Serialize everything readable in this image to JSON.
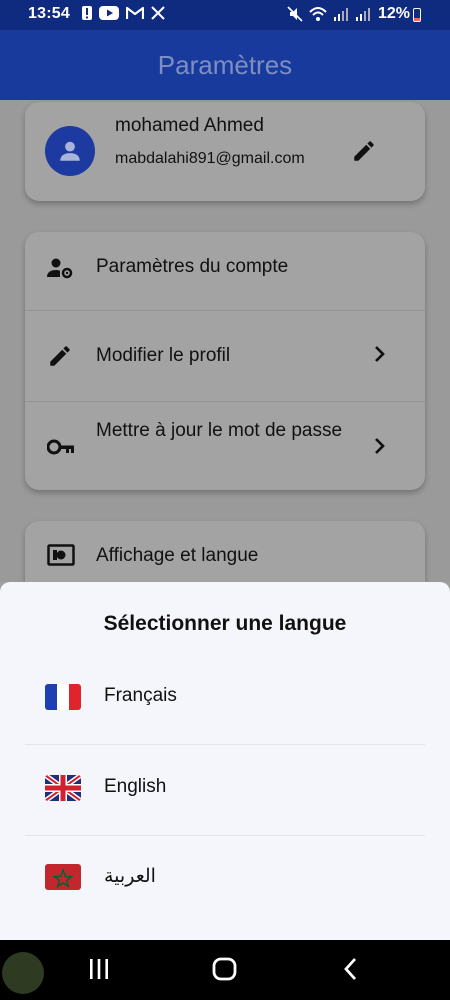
{
  "status_bar": {
    "time": "13:54",
    "battery": "12%",
    "left_icons": [
      "alert-icon",
      "youtube-icon",
      "gmail-icon",
      "x-icon"
    ],
    "right_icons": [
      "mute-icon",
      "wifi-icon",
      "signal-icon",
      "signal-icon"
    ]
  },
  "app_bar": {
    "title": "Paramètres"
  },
  "profile": {
    "name": "mohamed Ahmed",
    "email": "mabdalahi891@gmail.com"
  },
  "account_settings": {
    "items": [
      {
        "label": "Paramètres du compte",
        "icon": "user-gear-icon"
      },
      {
        "label": "Modifier le profil",
        "icon": "pencil-icon"
      },
      {
        "label": "Mettre à jour le mot de passe",
        "icon": "key-icon"
      }
    ]
  },
  "display": {
    "label": "Affichage et langue",
    "icon": "display-icon"
  },
  "language_sheet": {
    "title": "Sélectionner une langue",
    "options": [
      {
        "label": "Français",
        "flag": "france-flag-icon"
      },
      {
        "label": "English",
        "flag": "uk-flag-icon"
      },
      {
        "label": "العربية",
        "flag": "morocco-flag-icon"
      }
    ]
  },
  "colors": {
    "primary": "#173a9c",
    "status_bar": "#0f2b7f",
    "sheet_bg": "#f5f6fb",
    "scrim": "#9a9a9a"
  }
}
